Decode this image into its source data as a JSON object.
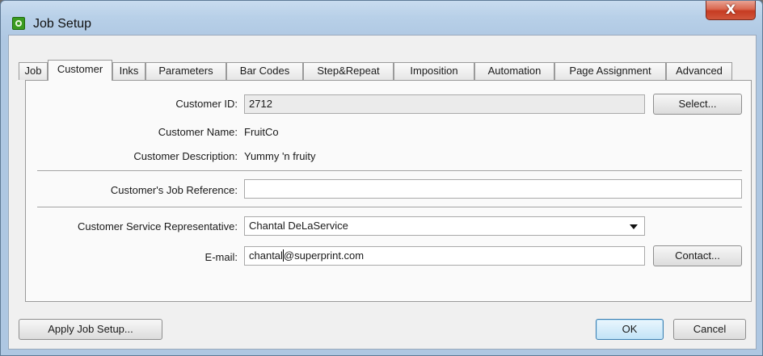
{
  "window": {
    "title": "Job Setup",
    "close_label": "X"
  },
  "tabs": [
    {
      "label": "Job"
    },
    {
      "label": "Customer",
      "active": true
    },
    {
      "label": "Inks"
    },
    {
      "label": "Parameters"
    },
    {
      "label": "Bar Codes"
    },
    {
      "label": "Step&Repeat"
    },
    {
      "label": "Imposition"
    },
    {
      "label": "Automation"
    },
    {
      "label": "Page Assignment"
    },
    {
      "label": "Advanced"
    }
  ],
  "customer": {
    "id_label": "Customer ID:",
    "id_value": "2712",
    "select_label": "Select...",
    "name_label": "Customer Name:",
    "name_value": "FruitCo",
    "description_label": "Customer Description:",
    "description_value": "Yummy 'n fruity",
    "job_ref_label": "Customer's Job Reference:",
    "job_ref_value": "",
    "csr_label": "Customer Service Representative:",
    "csr_value": "Chantal DeLaService",
    "email_label": "E-mail:",
    "email_value_before_cursor": "chantal",
    "email_value_after_cursor": "@superprint.com",
    "contact_label": "Contact..."
  },
  "footer": {
    "apply_label": "Apply Job Setup...",
    "ok_label": "OK",
    "cancel_label": "Cancel"
  }
}
